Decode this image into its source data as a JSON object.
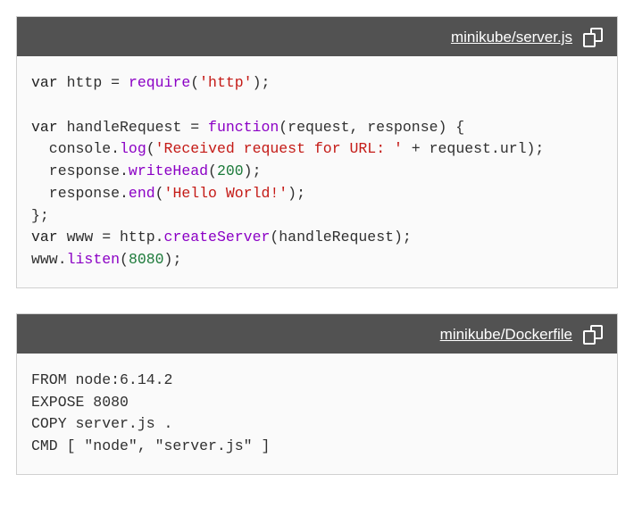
{
  "blocks": [
    {
      "filename": "minikube/server.js",
      "tokens": [
        [
          {
            "t": "kw",
            "v": "var"
          },
          {
            "t": "plain",
            "v": " http = "
          },
          {
            "t": "fn",
            "v": "require"
          },
          {
            "t": "plain",
            "v": "("
          },
          {
            "t": "str",
            "v": "'http'"
          },
          {
            "t": "plain",
            "v": ");"
          }
        ],
        [],
        [
          {
            "t": "kw",
            "v": "var"
          },
          {
            "t": "plain",
            "v": " handleRequest = "
          },
          {
            "t": "fn",
            "v": "function"
          },
          {
            "t": "plain",
            "v": "(request, response) {"
          }
        ],
        [
          {
            "t": "plain",
            "v": "  console."
          },
          {
            "t": "fn",
            "v": "log"
          },
          {
            "t": "plain",
            "v": "("
          },
          {
            "t": "str",
            "v": "'Received request for URL: '"
          },
          {
            "t": "plain",
            "v": " + request.url);"
          }
        ],
        [
          {
            "t": "plain",
            "v": "  response."
          },
          {
            "t": "fn",
            "v": "writeHead"
          },
          {
            "t": "plain",
            "v": "("
          },
          {
            "t": "num",
            "v": "200"
          },
          {
            "t": "plain",
            "v": ");"
          }
        ],
        [
          {
            "t": "plain",
            "v": "  response."
          },
          {
            "t": "fn",
            "v": "end"
          },
          {
            "t": "plain",
            "v": "("
          },
          {
            "t": "str",
            "v": "'Hello World!'"
          },
          {
            "t": "plain",
            "v": ");"
          }
        ],
        [
          {
            "t": "plain",
            "v": "};"
          }
        ],
        [
          {
            "t": "kw",
            "v": "var"
          },
          {
            "t": "plain",
            "v": " www = http."
          },
          {
            "t": "fn",
            "v": "createServer"
          },
          {
            "t": "plain",
            "v": "(handleRequest);"
          }
        ],
        [
          {
            "t": "plain",
            "v": "www."
          },
          {
            "t": "fn",
            "v": "listen"
          },
          {
            "t": "plain",
            "v": "("
          },
          {
            "t": "num",
            "v": "8080"
          },
          {
            "t": "plain",
            "v": ");"
          }
        ]
      ]
    },
    {
      "filename": "minikube/Dockerfile",
      "tokens": [
        [
          {
            "t": "plain",
            "v": "FROM node:6.14.2"
          }
        ],
        [
          {
            "t": "plain",
            "v": "EXPOSE 8080"
          }
        ],
        [
          {
            "t": "plain",
            "v": "COPY server.js ."
          }
        ],
        [
          {
            "t": "plain",
            "v": "CMD [ \"node\", \"server.js\" ]"
          }
        ]
      ]
    }
  ]
}
